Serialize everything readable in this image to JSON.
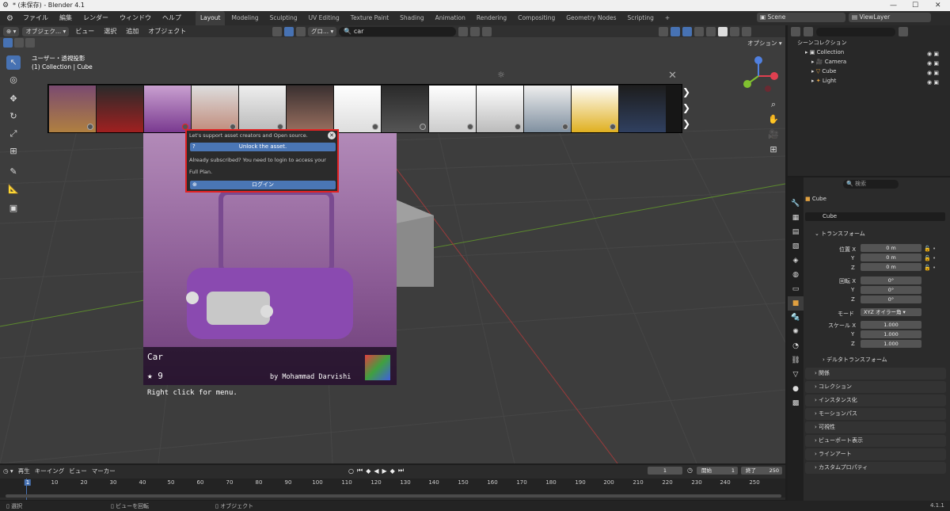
{
  "window": {
    "title": "* (未保存) - Blender 4.1",
    "version": "4.1.1"
  },
  "menus": [
    "ファイル",
    "編集",
    "レンダー",
    "ウィンドウ",
    "ヘルプ"
  ],
  "workspaces": [
    "Layout",
    "Modeling",
    "Sculpting",
    "UV Editing",
    "Texture Paint",
    "Shading",
    "Animation",
    "Rendering",
    "Compositing",
    "Geometry Nodes",
    "Scripting"
  ],
  "active_workspace": "Layout",
  "scene": {
    "scene_name": "Scene",
    "view_layer": "ViewLayer"
  },
  "viewport": {
    "mode": "オブジェク...",
    "menu": [
      "ビュー",
      "選択",
      "追加",
      "オブジェクト"
    ],
    "transform_orient": "グロ...",
    "search_value": "car",
    "options": "オプション",
    "info_line1": "ユーザー・透視投影",
    "info_line2": "(1) Collection | Cube"
  },
  "popup": {
    "line1": "Let's support asset creators and Open source.",
    "unlock": "Unlock the asset.",
    "line2": "Already subscribed? You need to login to access your",
    "line3": "Full Plan.",
    "login": "ログイン"
  },
  "preview": {
    "name": "Car",
    "stars": "9",
    "author": "by Mohammad Darvishi",
    "hint": "Right click for menu."
  },
  "outliner": {
    "title": "シーンコレクション",
    "items": [
      {
        "label": "Collection"
      },
      {
        "label": "Camera"
      },
      {
        "label": "Cube"
      },
      {
        "label": "Light"
      }
    ]
  },
  "properties": {
    "search_placeholder": "検索",
    "object_name": "Cube",
    "object_field": "Cube",
    "transform_title": "トランスフォーム",
    "location_label": "位置 X",
    "rotation_label": "回転 X",
    "scale_label": "スケール X",
    "axis_y": "Y",
    "axis_z": "Z",
    "loc": [
      "0 m",
      "0 m",
      "0 m"
    ],
    "rot": [
      "0°",
      "0°",
      "0°"
    ],
    "mode_label": "モード",
    "mode_value": "XYZ オイラー角",
    "scale": [
      "1.000",
      "1.000",
      "1.000"
    ],
    "delta": "デルタトランスフォーム",
    "panels": [
      "関係",
      "コレクション",
      "インスタンス化",
      "モーションパス",
      "可視性",
      "ビューポート表示",
      "ラインアート",
      "カスタムプロパティ"
    ]
  },
  "timeline": {
    "menu": [
      "再生",
      "キーイング",
      "ビュー",
      "マーカー"
    ],
    "current": "1",
    "start_label": "開始",
    "start": "1",
    "end_label": "終了",
    "end": "250",
    "ticks": [
      "1",
      "10",
      "20",
      "30",
      "40",
      "50",
      "60",
      "70",
      "80",
      "90",
      "100",
      "110",
      "120",
      "130",
      "140",
      "150",
      "160",
      "170",
      "180",
      "190",
      "200",
      "210",
      "220",
      "230",
      "240",
      "250"
    ]
  },
  "status": {
    "select": "選択",
    "rotate": "ビューを回転",
    "object": "オブジェクト"
  }
}
